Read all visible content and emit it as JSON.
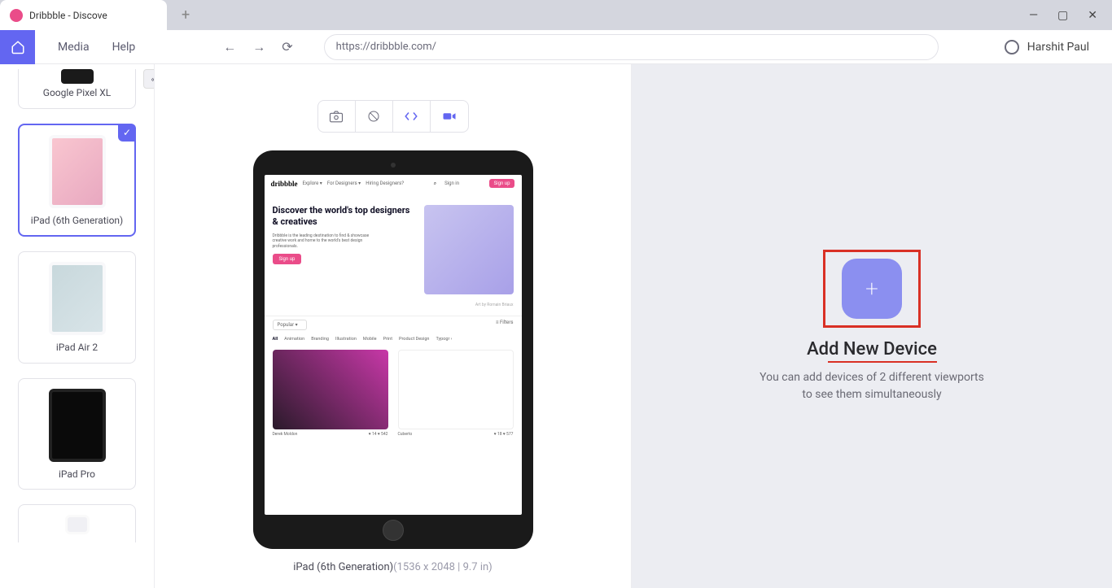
{
  "tab": {
    "title": "Dribbble - Discove"
  },
  "toolbar": {
    "media_label": "Media",
    "help_label": "Help",
    "url": "https://dribbble.com/",
    "username": "Harshit Paul"
  },
  "devices": [
    {
      "name": "Google Pixel XL",
      "thumb_class": "pixel",
      "selected": false,
      "first": true
    },
    {
      "name": "iPad (6th Generation)",
      "thumb_class": "",
      "selected": true,
      "first": false
    },
    {
      "name": "iPad Air 2",
      "thumb_class": "air2",
      "selected": false,
      "first": false
    },
    {
      "name": "iPad Pro",
      "thumb_class": "pro",
      "selected": false,
      "first": false
    },
    {
      "name": "",
      "thumb_class": "iphone",
      "selected": false,
      "first": false
    }
  ],
  "preview": {
    "caption_name": "iPad (6th Generation)",
    "caption_dims": "(1536 x 2048 | 9.7 in)"
  },
  "dribbble": {
    "logo": "dribbble",
    "nav1": "Explore ▾",
    "nav2": "For Designers ▾",
    "nav3": "Hiring Designers?",
    "signin": "Sign in",
    "signup": "Sign up",
    "hero_title": "Discover the world's top designers & creatives",
    "hero_sub": "Dribbble is the leading destination to find & showcase creative work and home to the world's best design professionals.",
    "hero_signup": "Sign up",
    "hero_credit": "Art by Romain Briaux",
    "popular": "Popular  ▾",
    "filters": "≡ Filters",
    "categories": [
      "All",
      "Animation",
      "Branding",
      "Illustration",
      "Mobile",
      "Print",
      "Product Design",
      "Typogr  ›"
    ],
    "shot1_author": "Derek Moldon",
    "shot1_likes": "♥ 14  ♥ 542",
    "shot2_author": "Cuberto",
    "shot2_likes": "♥ 18  ♥ 577"
  },
  "add_pane": {
    "title": "Add New Device",
    "desc": "You can add devices of 2 different viewports to see them simultaneously"
  }
}
